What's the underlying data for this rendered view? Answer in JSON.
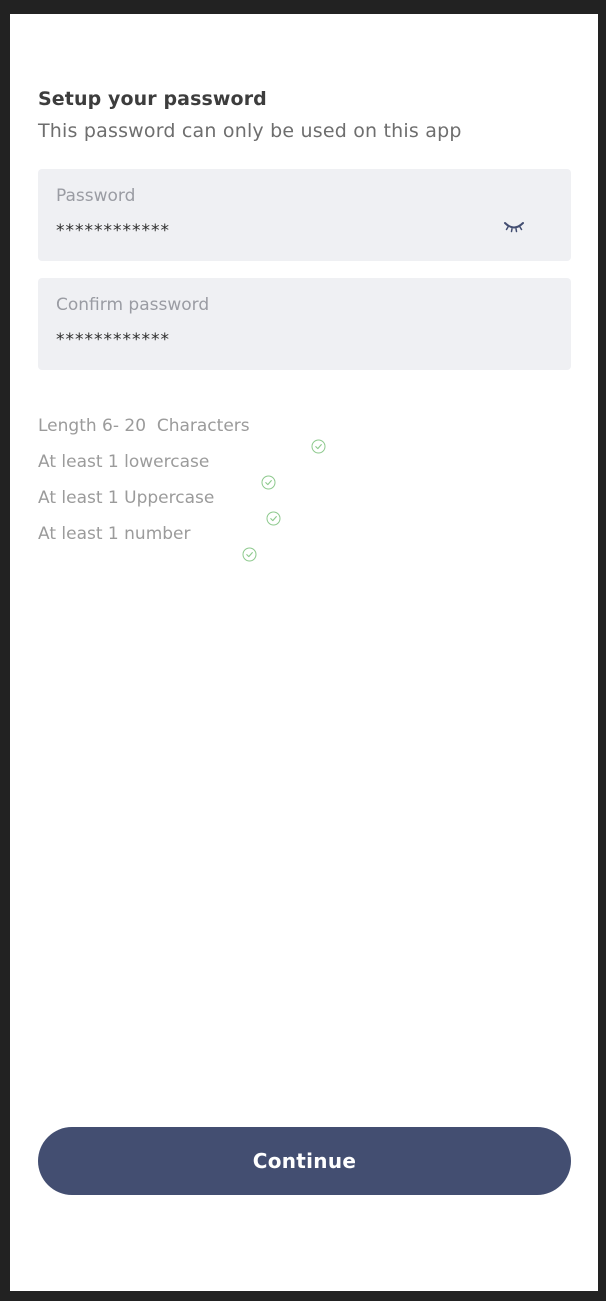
{
  "header": {
    "title": "Setup your password",
    "subtitle": "This password can only be used on this app"
  },
  "password_field": {
    "label": "Password",
    "value": "************",
    "toggle_icon": "eye-closed-icon"
  },
  "confirm_field": {
    "label": "Confirm password",
    "value": "************"
  },
  "requirements": [
    {
      "label": "Length 6- 20  Characters",
      "met": true
    },
    {
      "label": "At least 1 lowercase",
      "met": true
    },
    {
      "label": "At least 1 Uppercase",
      "met": true
    },
    {
      "label": "At least 1 number",
      "met": true
    }
  ],
  "colors": {
    "accent": "#434e71",
    "check": "#8dc98d",
    "field_bg": "#eff0f3"
  },
  "continue_button": {
    "label": "Continue"
  }
}
